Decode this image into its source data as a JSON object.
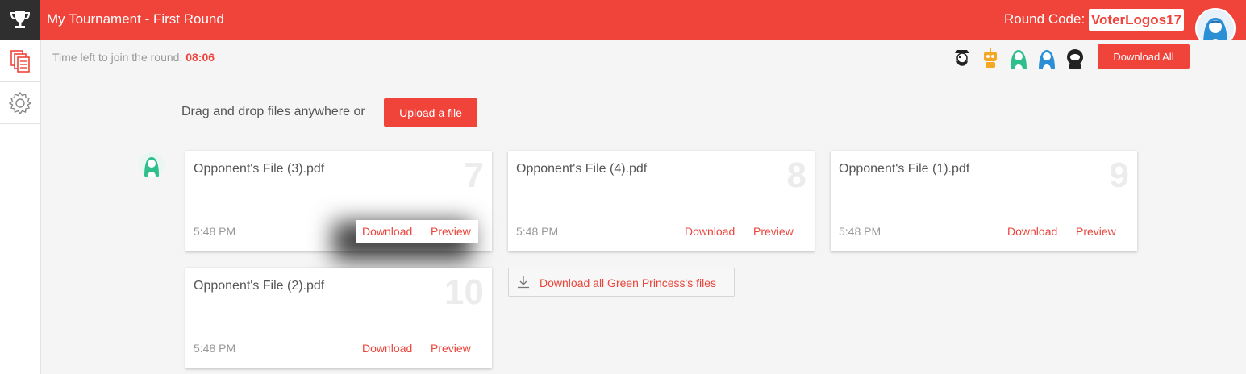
{
  "header": {
    "title": "My Tournament - First Round",
    "round_code_label": "Round Code:",
    "round_code_value": "VoterLogos17",
    "logo_icon": "trophy-icon",
    "avatar_icon": "blue-princess-avatar"
  },
  "sidebar": {
    "items": [
      {
        "icon": "files-icon",
        "active": true
      },
      {
        "icon": "gear-icon",
        "active": false
      }
    ]
  },
  "subheader": {
    "timer_label": "Time left to join the round:",
    "timer_value": "08:06",
    "players": [
      "pirate-avatar",
      "robot-avatar",
      "green-princess-avatar",
      "blue-princess-avatar",
      "astronaut-avatar"
    ],
    "download_all_label": "Download All"
  },
  "upload": {
    "drag_text": "Drag and drop files anywhere or",
    "upload_label": "Upload a file"
  },
  "owner": {
    "avatar": "green-princess-avatar",
    "download_all_label": "Download all Green Princess's files"
  },
  "files": [
    {
      "name": "Opponent's File (3).pdf",
      "number": "7",
      "time": "5:48 PM",
      "download": "Download",
      "preview": "Preview"
    },
    {
      "name": "Opponent's File (4).pdf",
      "number": "8",
      "time": "5:48 PM",
      "download": "Download",
      "preview": "Preview"
    },
    {
      "name": "Opponent's File (1).pdf",
      "number": "9",
      "time": "5:48 PM",
      "download": "Download",
      "preview": "Preview"
    },
    {
      "name": "Opponent's File (2).pdf",
      "number": "10",
      "time": "5:48 PM",
      "download": "Download",
      "preview": "Preview"
    }
  ],
  "colors": {
    "accent": "#f0433a",
    "sidebar_dark": "#2f2f2f",
    "green_princess": "#2fbf8c",
    "blue_princess": "#2b8fd6"
  }
}
